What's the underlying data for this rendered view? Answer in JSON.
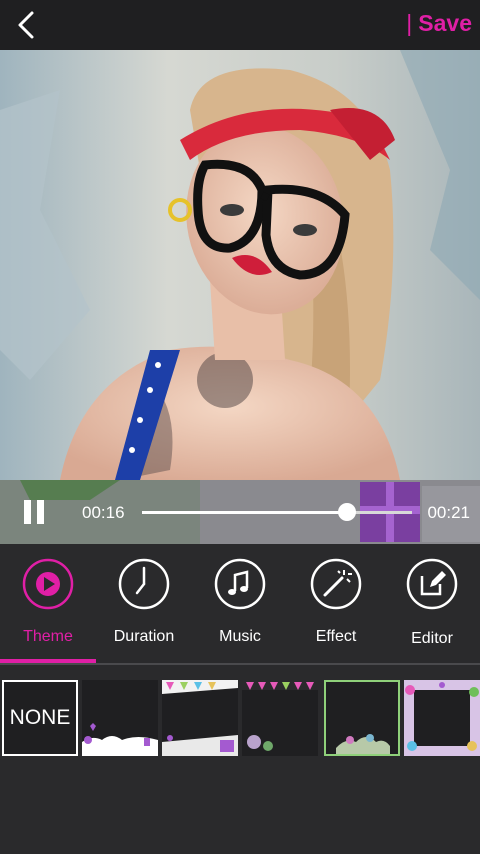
{
  "header": {
    "back_icon": "chevron-left-icon",
    "save_label": "Save",
    "accent_color": "#e01fa6"
  },
  "player": {
    "current_time": "00:16",
    "total_time": "00:21",
    "progress": 0.76,
    "pause_icon": "pause-icon"
  },
  "tabs": [
    {
      "label": "Theme",
      "icon": "play-circle-icon",
      "active": true
    },
    {
      "label": "Duration",
      "icon": "clock-icon",
      "active": false
    },
    {
      "label": "Music",
      "icon": "music-note-icon",
      "active": false
    },
    {
      "label": "Effect",
      "icon": "magic-wand-icon",
      "active": false
    },
    {
      "label": "Editor",
      "icon": "edit-icon",
      "active": false
    }
  ],
  "themes": {
    "none_label": "NONE"
  }
}
